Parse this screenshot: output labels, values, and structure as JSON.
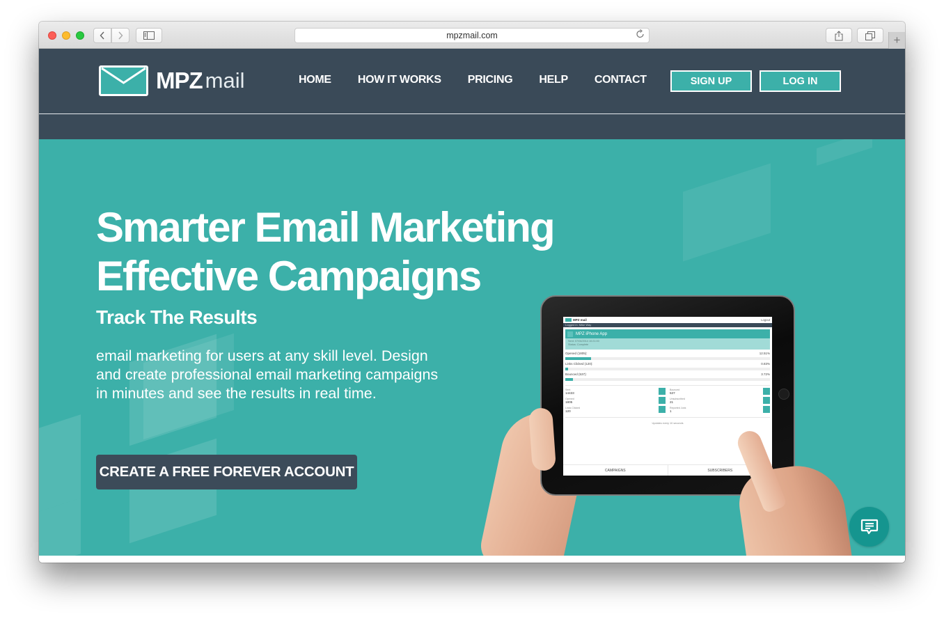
{
  "browser": {
    "url": "mpzmail.com",
    "buttons": {
      "back": "back-icon",
      "forward": "forward-icon",
      "sidebar": "sidebar-icon",
      "reload": "reload-icon",
      "share": "share-icon",
      "tabs": "tabs-icon",
      "new_tab": "plus-icon"
    }
  },
  "header": {
    "logo": {
      "bold": "MPZ",
      "light": "mail"
    },
    "nav": [
      {
        "label": "HOME"
      },
      {
        "label": "HOW IT WORKS"
      },
      {
        "label": "PRICING"
      },
      {
        "label": "HELP"
      },
      {
        "label": "CONTACT"
      }
    ],
    "signup_label": "SIGN UP",
    "login_label": "LOG IN"
  },
  "hero": {
    "title_line1": "Smarter Email Marketing",
    "title_line2": "Effective Campaigns",
    "subtitle": "Track The Results",
    "description": "email marketing for users at any skill level. Design and create professional email marketing campaigns in minutes and see the results in real time.",
    "cta_label": "CREATE A FREE FOREVER ACCOUNT"
  },
  "tablet_screen": {
    "logo": "MPZ mail",
    "logout": "Logout",
    "logged_in": "Logged in: Mike Way",
    "campaign_title": "MPZ iPhone App",
    "sent_date": "Sent: 07/04/2014 10:21:00",
    "status": "Status: Complete",
    "stats": [
      {
        "label": "Opened (1805):",
        "percent_text": "12.51%",
        "percent": 12.51
      },
      {
        "label": "Links Clicked (120):",
        "percent_text": "0.83%",
        "percent": 0.83
      },
      {
        "label": "Bounced (537):",
        "percent_text": "3.72%",
        "percent": 3.72
      }
    ],
    "metrics": [
      {
        "label": "Sent",
        "value": "14433"
      },
      {
        "label": "Bounced",
        "value": "537"
      },
      {
        "label": "Opened",
        "value": "1805"
      },
      {
        "label": "Unsubscribed",
        "value": "21"
      },
      {
        "label": "Links Clicked",
        "value": "120"
      },
      {
        "label": "Reported Junk",
        "value": "1"
      }
    ],
    "update_note": "Updates every 10 seconds",
    "tabs": [
      "CAMPAIGNS",
      "SUBSCRIBERS"
    ]
  },
  "chat": {
    "icon": "chat-icon"
  },
  "colors": {
    "header_bg": "#3a4a58",
    "accent": "#3cb0a9",
    "cta_bg": "#3c4b59",
    "chat_bg": "#15958f"
  }
}
